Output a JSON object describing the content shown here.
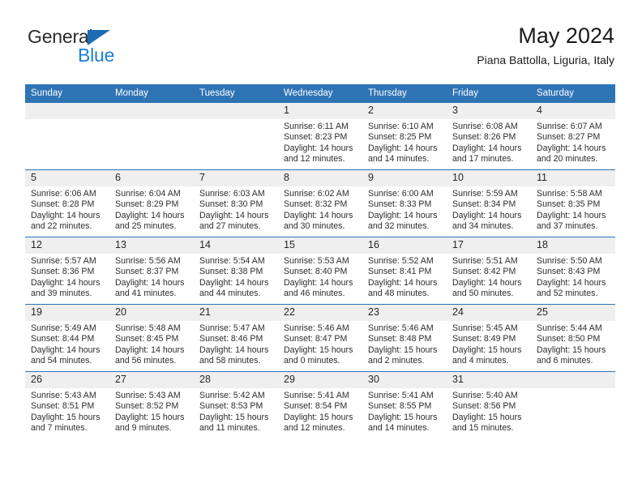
{
  "logo": {
    "word_one": "General",
    "word_two": "Blue",
    "triangle_icon": "triangle-icon",
    "brand_blue": "#1b7fd4",
    "brand_dark": "#2b2b2b"
  },
  "header": {
    "title": "May 2024",
    "subtitle": "Piana Battolla, Liguria, Italy"
  },
  "theme": {
    "header_blue": "#2e74b5",
    "daynum_bg": "#efefef",
    "text": "#2d2d2d"
  },
  "calendar": {
    "weekday_headers": [
      "Sunday",
      "Monday",
      "Tuesday",
      "Wednesday",
      "Thursday",
      "Friday",
      "Saturday"
    ],
    "weeks": [
      [
        {
          "day": "",
          "sunrise": "",
          "sunset": "",
          "daylight": ""
        },
        {
          "day": "",
          "sunrise": "",
          "sunset": "",
          "daylight": ""
        },
        {
          "day": "",
          "sunrise": "",
          "sunset": "",
          "daylight": ""
        },
        {
          "day": "1",
          "sunrise": "Sunrise: 6:11 AM",
          "sunset": "Sunset: 8:23 PM",
          "daylight": "Daylight: 14 hours and 12 minutes."
        },
        {
          "day": "2",
          "sunrise": "Sunrise: 6:10 AM",
          "sunset": "Sunset: 8:25 PM",
          "daylight": "Daylight: 14 hours and 14 minutes."
        },
        {
          "day": "3",
          "sunrise": "Sunrise: 6:08 AM",
          "sunset": "Sunset: 8:26 PM",
          "daylight": "Daylight: 14 hours and 17 minutes."
        },
        {
          "day": "4",
          "sunrise": "Sunrise: 6:07 AM",
          "sunset": "Sunset: 8:27 PM",
          "daylight": "Daylight: 14 hours and 20 minutes."
        }
      ],
      [
        {
          "day": "5",
          "sunrise": "Sunrise: 6:06 AM",
          "sunset": "Sunset: 8:28 PM",
          "daylight": "Daylight: 14 hours and 22 minutes."
        },
        {
          "day": "6",
          "sunrise": "Sunrise: 6:04 AM",
          "sunset": "Sunset: 8:29 PM",
          "daylight": "Daylight: 14 hours and 25 minutes."
        },
        {
          "day": "7",
          "sunrise": "Sunrise: 6:03 AM",
          "sunset": "Sunset: 8:30 PM",
          "daylight": "Daylight: 14 hours and 27 minutes."
        },
        {
          "day": "8",
          "sunrise": "Sunrise: 6:02 AM",
          "sunset": "Sunset: 8:32 PM",
          "daylight": "Daylight: 14 hours and 30 minutes."
        },
        {
          "day": "9",
          "sunrise": "Sunrise: 6:00 AM",
          "sunset": "Sunset: 8:33 PM",
          "daylight": "Daylight: 14 hours and 32 minutes."
        },
        {
          "day": "10",
          "sunrise": "Sunrise: 5:59 AM",
          "sunset": "Sunset: 8:34 PM",
          "daylight": "Daylight: 14 hours and 34 minutes."
        },
        {
          "day": "11",
          "sunrise": "Sunrise: 5:58 AM",
          "sunset": "Sunset: 8:35 PM",
          "daylight": "Daylight: 14 hours and 37 minutes."
        }
      ],
      [
        {
          "day": "12",
          "sunrise": "Sunrise: 5:57 AM",
          "sunset": "Sunset: 8:36 PM",
          "daylight": "Daylight: 14 hours and 39 minutes."
        },
        {
          "day": "13",
          "sunrise": "Sunrise: 5:56 AM",
          "sunset": "Sunset: 8:37 PM",
          "daylight": "Daylight: 14 hours and 41 minutes."
        },
        {
          "day": "14",
          "sunrise": "Sunrise: 5:54 AM",
          "sunset": "Sunset: 8:38 PM",
          "daylight": "Daylight: 14 hours and 44 minutes."
        },
        {
          "day": "15",
          "sunrise": "Sunrise: 5:53 AM",
          "sunset": "Sunset: 8:40 PM",
          "daylight": "Daylight: 14 hours and 46 minutes."
        },
        {
          "day": "16",
          "sunrise": "Sunrise: 5:52 AM",
          "sunset": "Sunset: 8:41 PM",
          "daylight": "Daylight: 14 hours and 48 minutes."
        },
        {
          "day": "17",
          "sunrise": "Sunrise: 5:51 AM",
          "sunset": "Sunset: 8:42 PM",
          "daylight": "Daylight: 14 hours and 50 minutes."
        },
        {
          "day": "18",
          "sunrise": "Sunrise: 5:50 AM",
          "sunset": "Sunset: 8:43 PM",
          "daylight": "Daylight: 14 hours and 52 minutes."
        }
      ],
      [
        {
          "day": "19",
          "sunrise": "Sunrise: 5:49 AM",
          "sunset": "Sunset: 8:44 PM",
          "daylight": "Daylight: 14 hours and 54 minutes."
        },
        {
          "day": "20",
          "sunrise": "Sunrise: 5:48 AM",
          "sunset": "Sunset: 8:45 PM",
          "daylight": "Daylight: 14 hours and 56 minutes."
        },
        {
          "day": "21",
          "sunrise": "Sunrise: 5:47 AM",
          "sunset": "Sunset: 8:46 PM",
          "daylight": "Daylight: 14 hours and 58 minutes."
        },
        {
          "day": "22",
          "sunrise": "Sunrise: 5:46 AM",
          "sunset": "Sunset: 8:47 PM",
          "daylight": "Daylight: 15 hours and 0 minutes."
        },
        {
          "day": "23",
          "sunrise": "Sunrise: 5:46 AM",
          "sunset": "Sunset: 8:48 PM",
          "daylight": "Daylight: 15 hours and 2 minutes."
        },
        {
          "day": "24",
          "sunrise": "Sunrise: 5:45 AM",
          "sunset": "Sunset: 8:49 PM",
          "daylight": "Daylight: 15 hours and 4 minutes."
        },
        {
          "day": "25",
          "sunrise": "Sunrise: 5:44 AM",
          "sunset": "Sunset: 8:50 PM",
          "daylight": "Daylight: 15 hours and 6 minutes."
        }
      ],
      [
        {
          "day": "26",
          "sunrise": "Sunrise: 5:43 AM",
          "sunset": "Sunset: 8:51 PM",
          "daylight": "Daylight: 15 hours and 7 minutes."
        },
        {
          "day": "27",
          "sunrise": "Sunrise: 5:43 AM",
          "sunset": "Sunset: 8:52 PM",
          "daylight": "Daylight: 15 hours and 9 minutes."
        },
        {
          "day": "28",
          "sunrise": "Sunrise: 5:42 AM",
          "sunset": "Sunset: 8:53 PM",
          "daylight": "Daylight: 15 hours and 11 minutes."
        },
        {
          "day": "29",
          "sunrise": "Sunrise: 5:41 AM",
          "sunset": "Sunset: 8:54 PM",
          "daylight": "Daylight: 15 hours and 12 minutes."
        },
        {
          "day": "30",
          "sunrise": "Sunrise: 5:41 AM",
          "sunset": "Sunset: 8:55 PM",
          "daylight": "Daylight: 15 hours and 14 minutes."
        },
        {
          "day": "31",
          "sunrise": "Sunrise: 5:40 AM",
          "sunset": "Sunset: 8:56 PM",
          "daylight": "Daylight: 15 hours and 15 minutes."
        },
        {
          "day": "",
          "sunrise": "",
          "sunset": "",
          "daylight": ""
        }
      ]
    ]
  }
}
